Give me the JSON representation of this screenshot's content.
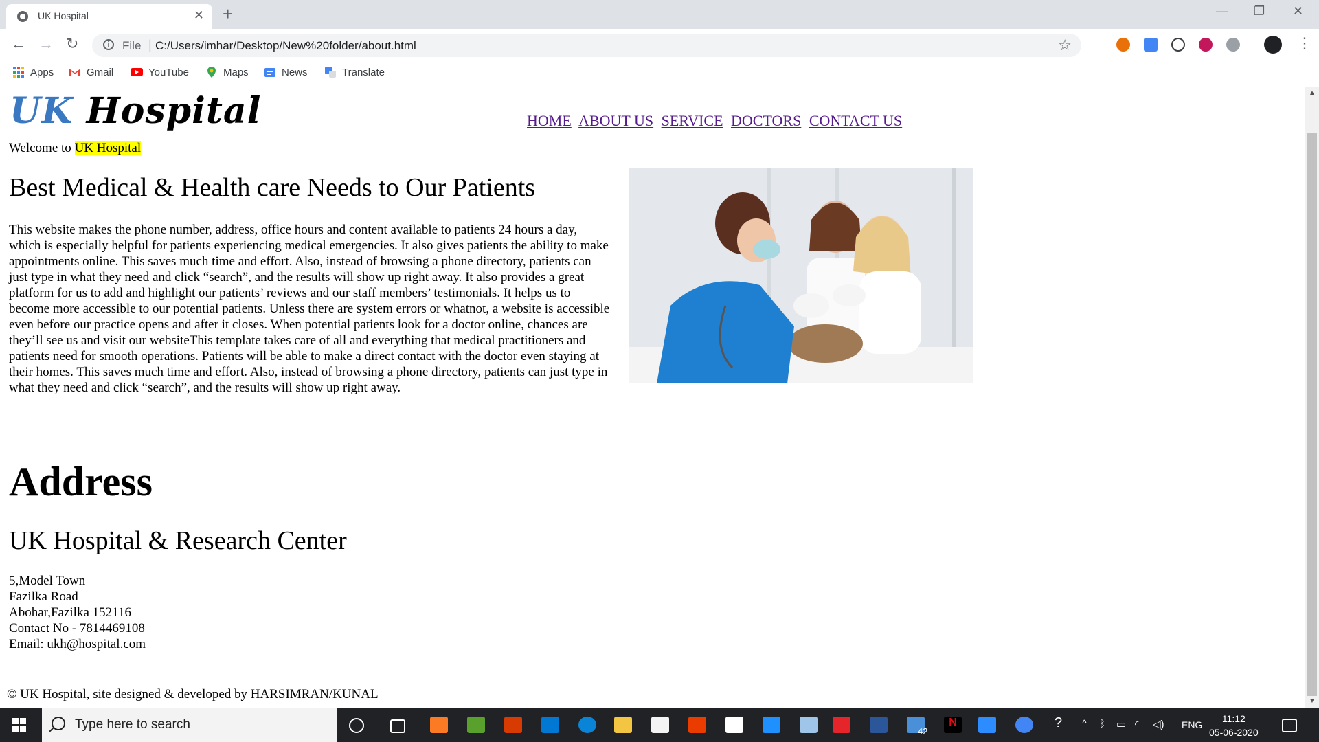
{
  "browser": {
    "tab_title": "UK Hospital",
    "url_scheme": "File",
    "url": "C:/Users/imhar/Desktop/New%20folder/about.html",
    "bookmarks": [
      "Apps",
      "Gmail",
      "YouTube",
      "Maps",
      "News",
      "Translate"
    ]
  },
  "site": {
    "logo_uk": "UK",
    "logo_hospital": "Hospital",
    "nav": [
      "HOME",
      "ABOUT US",
      "SERVICE",
      "DOCTORS",
      "CONTACT US"
    ],
    "welcome_prefix": "Welcome to",
    "welcome_highlight": "UK Hospital",
    "headline": "Best Medical & Health care Needs to Our Patients",
    "paragraph": "This website makes the phone number, address, office hours and content available to patients 24 hours a day, which is especially helpful for patients experiencing medical emergencies. It also gives patients the ability to make appointments online. This saves much time and effort. Also, instead of browsing a phone directory, patients can just type in what they need and click “search”, and the results will show up right away. It also provides a great platform for us to add and highlight our patients’ reviews and our staff members’ testimonials. It helps us to become more accessible to our potential patients. Unless there are system errors or whatnot, a website is accessible even before our practice opens and after it closes. When potential patients look for a doctor online, chances are they’ll see us and visit our websiteThis template takes care of all and everything that medical practitioners and patients need for smooth operations. Patients will be able to make a direct contact with the doctor even staying at their homes. This saves much time and effort. Also, instead of browsing a phone directory, patients can just type in what they need and click “search”, and the results will show up right away.",
    "address_heading": "Address",
    "center_name": "UK Hospital & Research Center",
    "address_lines": [
      "5,Model Town",
      "Fazilka Road",
      "Abohar,Fazilka 152116",
      "Contact No - 7814469108",
      "Email: ukh@hospital.com"
    ],
    "footer": "© UK Hospital, site designed & developed by HARSIMRAN/KUNAL"
  },
  "taskbar": {
    "search_placeholder": "Type here to search",
    "mail_badge": "42",
    "language": "ENG",
    "time": "11:12",
    "date": "05-06-2020"
  }
}
